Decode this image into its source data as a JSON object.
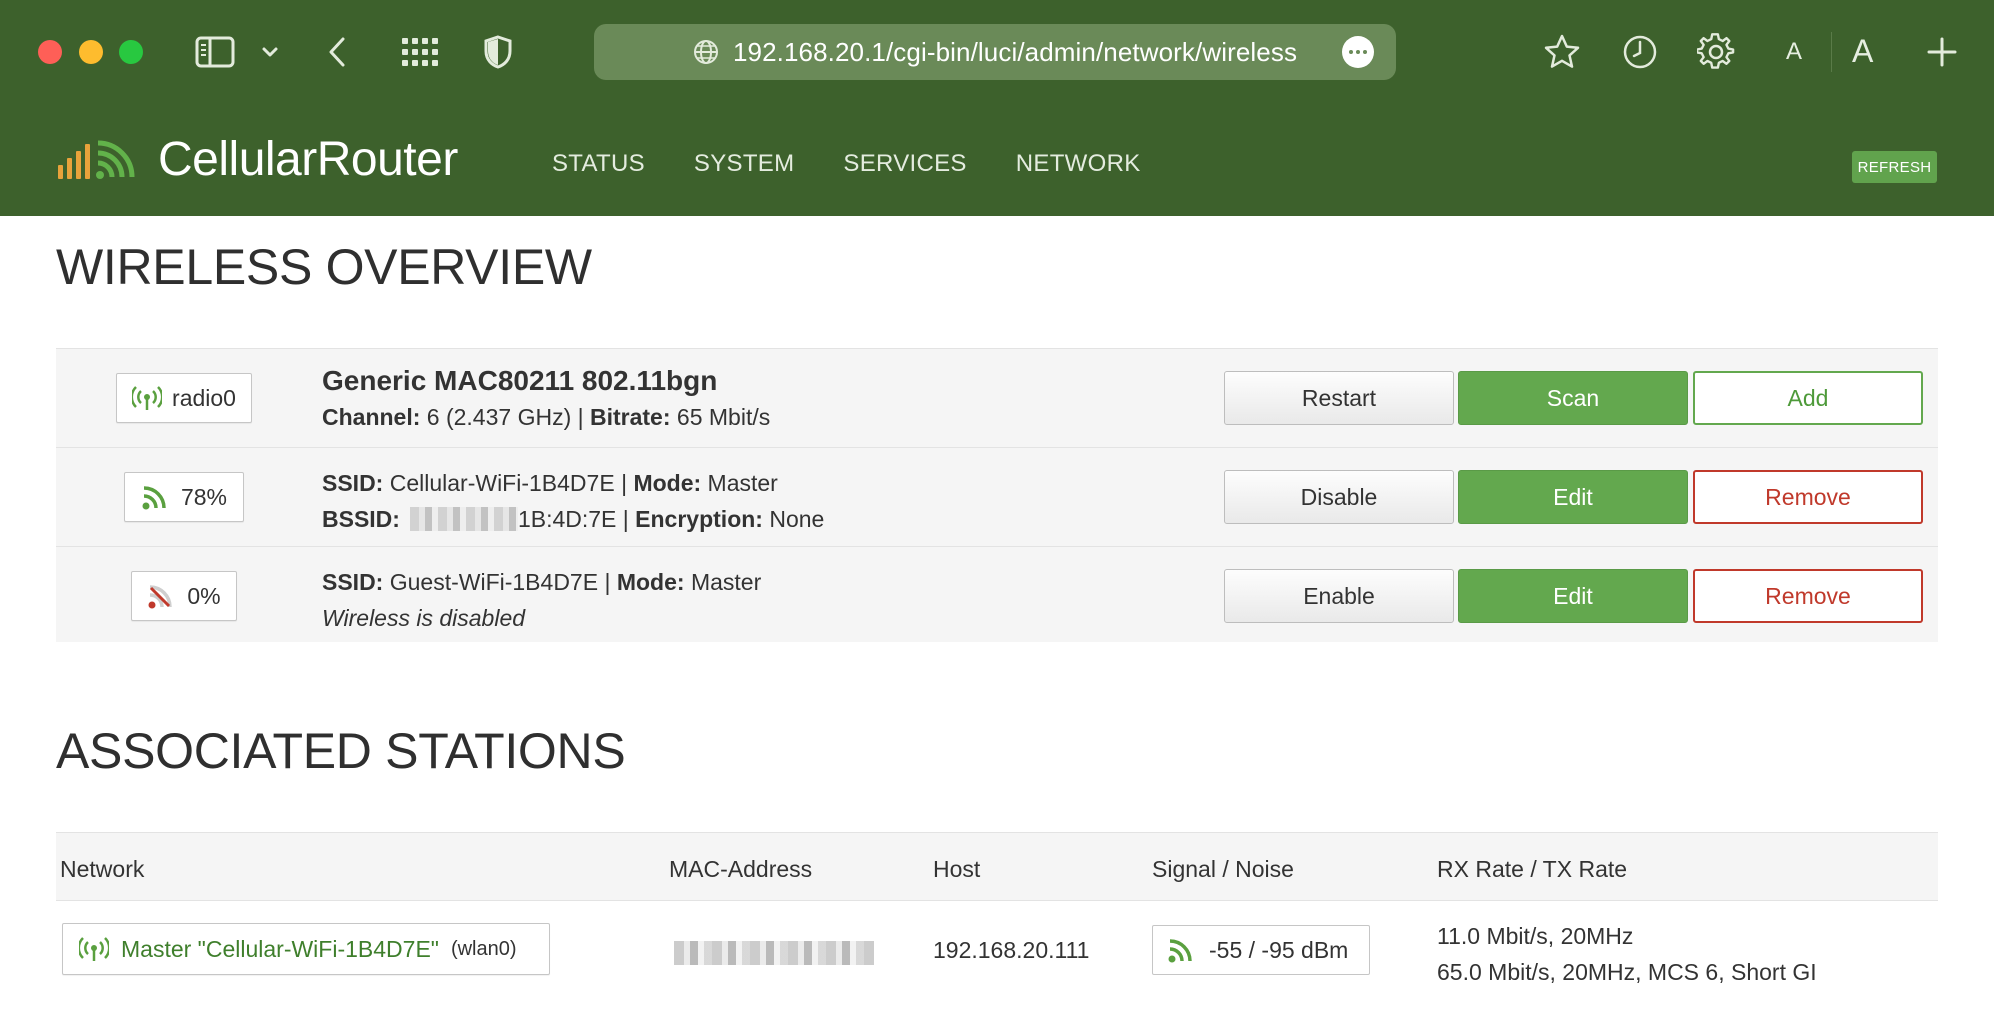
{
  "browser": {
    "url": "192.168.20.1/cgi-bin/luci/admin/network/wireless",
    "font_small": "A",
    "font_large": "A"
  },
  "app": {
    "brand": "CellularRouter",
    "nav": [
      "STATUS",
      "SYSTEM",
      "SERVICES",
      "NETWORK"
    ],
    "refresh_label": "REFRESH"
  },
  "wireless": {
    "title": "WIRELESS OVERVIEW",
    "radio": {
      "badge": "radio0",
      "name": "Generic MAC80211 802.11bgn",
      "channel_label": "Channel:",
      "channel_value": "6 (2.437 GHz)",
      "bitrate_label": "Bitrate:",
      "bitrate_value": "65 Mbit/s",
      "buttons": [
        "Restart",
        "Scan",
        "Add"
      ]
    },
    "networks": [
      {
        "badge": "78%",
        "ssid_label": "SSID:",
        "ssid": "Cellular-WiFi-1B4D7E",
        "mode_label": "Mode:",
        "mode": "Master",
        "bssid_label": "BSSID:",
        "bssid_visible": "1B:4D:7E",
        "encryption_label": "Encryption:",
        "encryption": "None",
        "buttons": [
          "Disable",
          "Edit",
          "Remove"
        ]
      },
      {
        "badge": "0%",
        "ssid_label": "SSID:",
        "ssid": "Guest-WiFi-1B4D7E",
        "mode_label": "Mode:",
        "mode": "Master",
        "status": "Wireless is disabled",
        "buttons": [
          "Enable",
          "Edit",
          "Remove"
        ]
      }
    ]
  },
  "stations": {
    "title": "ASSOCIATED STATIONS",
    "columns": [
      "Network",
      "MAC-Address",
      "Host",
      "Signal / Noise",
      "RX Rate / TX Rate"
    ],
    "rows": [
      {
        "network": "Master \"Cellular-WiFi-1B4D7E\"",
        "iface": "(wlan0)",
        "host": "192.168.20.111",
        "signal_noise": "-55 / -95 dBm",
        "rx_rate": "11.0 Mbit/s, 20MHz",
        "tx_rate": "65.0 Mbit/s, 20MHz, MCS 6, Short GI"
      }
    ]
  },
  "colors": {
    "header": "#3d612c",
    "accent_green": "#63a84e",
    "danger_red": "#c0392b"
  }
}
